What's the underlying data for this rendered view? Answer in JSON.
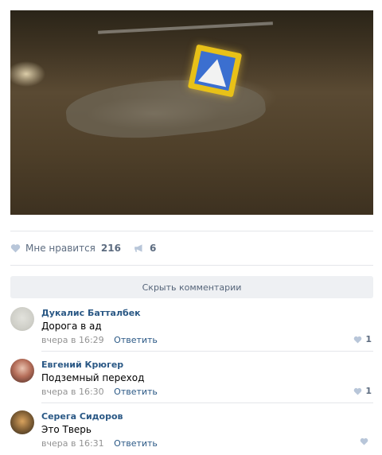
{
  "post": {
    "likes_label": "Мне нравится",
    "likes_count": "216",
    "shares_count": "6",
    "hide_comments_label": "Скрыть комментарии"
  },
  "comments": [
    {
      "author": "Дукалис Батталбек",
      "text": "Дорога в ад",
      "time": "вчера в 16:29",
      "reply_label": "Ответить",
      "likes": "1"
    },
    {
      "author": "Евгений Крюгер",
      "text": "Подземный переход",
      "time": "вчера в 16:30",
      "reply_label": "Ответить",
      "likes": "1"
    },
    {
      "author": "Серега Сидоров",
      "text": "Это Тверь",
      "time": "вчера в 16:31",
      "reply_label": "Ответить",
      "likes": ""
    }
  ],
  "colors": {
    "link": "#2a5885",
    "muted": "#939393",
    "action": "#5d6c80",
    "heart": "#b8c6d9"
  },
  "icons": {
    "like": "heart-icon",
    "share": "megaphone-icon"
  }
}
